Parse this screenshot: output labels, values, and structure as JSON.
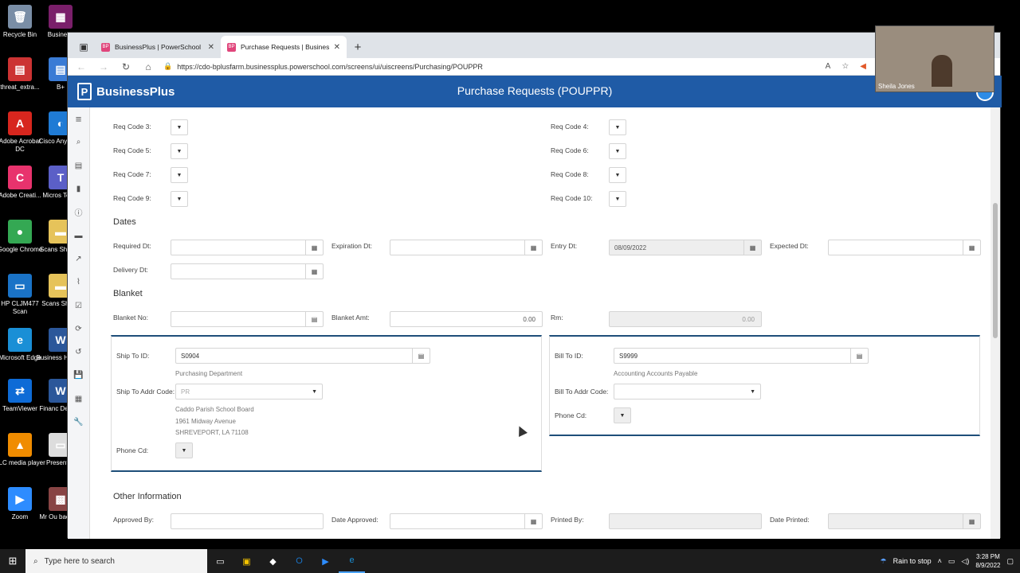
{
  "desktop": {
    "icons": [
      {
        "label": "Recycle Bin",
        "color": "#7a8ea6",
        "glyph": "🗑"
      },
      {
        "label": "threat_extra...",
        "color": "#cc3333",
        "glyph": "▤"
      },
      {
        "label": "Adobe Acrobat DC",
        "color": "#d7261e",
        "glyph": "A"
      },
      {
        "label": "Adobe Creati...",
        "color": "#e8336d",
        "glyph": "C"
      },
      {
        "label": "Google Chrome",
        "color": "#34a853",
        "glyph": "●"
      },
      {
        "label": "HP CLJM477 Scan",
        "color": "#1a73c7",
        "glyph": "▭"
      },
      {
        "label": "Microsoft Edge",
        "color": "#1a8fd6",
        "glyph": "e"
      },
      {
        "label": "TeamViewer",
        "color": "#0e6bd6",
        "glyph": "⇄"
      },
      {
        "label": "VLC media player",
        "color": "#f08c00",
        "glyph": "▲"
      },
      {
        "label": "Zoom",
        "color": "#2d8cff",
        "glyph": "▶"
      }
    ],
    "icons2": [
      {
        "label": "Business",
        "color": "#7a1f6a",
        "glyph": "▦"
      },
      {
        "label": "B+",
        "color": "#3a7bd5",
        "glyph": "▤"
      },
      {
        "label": "Cisco AnyConn",
        "color": "#1f7bd5",
        "glyph": "◐"
      },
      {
        "label": "Micros Team",
        "color": "#5b5fc7",
        "glyph": "T"
      },
      {
        "label": "Scans Shortcu",
        "color": "#e6c35a",
        "glyph": "▬"
      },
      {
        "label": "Scans Shortc",
        "color": "#e6c35a",
        "glyph": "▬"
      },
      {
        "label": "Business How To",
        "color": "#2b579a",
        "glyph": "W"
      },
      {
        "label": "Financ Deadlin",
        "color": "#2b579a",
        "glyph": "W"
      },
      {
        "label": "Presentati",
        "color": "#dddddd",
        "glyph": "▭"
      },
      {
        "label": "Mr Ou backgro",
        "color": "#884444",
        "glyph": "▩"
      }
    ]
  },
  "browser": {
    "tabs": [
      {
        "title": "BusinessPlus | PowerSchool",
        "active": false
      },
      {
        "title": "Purchase Requests | BusinessPlu",
        "active": true
      }
    ],
    "url": "https://cdo-bplusfarm.businessplus.powerschool.com/screens/ui/uiscreens/Purchasing/POUPPR"
  },
  "app": {
    "brand": "BusinessPlus",
    "title": "Purchase Requests (POUPPR)"
  },
  "form": {
    "req_codes": {
      "code3": "Req Code 3:",
      "code4": "Req Code 4:",
      "code5": "Req Code 5:",
      "code6": "Req Code 6:",
      "code7": "Req Code 7:",
      "code8": "Req Code 8:",
      "code9": "Req Code 9:",
      "code10": "Req Code 10:"
    },
    "dates": {
      "title": "Dates",
      "required_label": "Required Dt:",
      "expiration_label": "Expiration Dt:",
      "entry_label": "Entry Dt:",
      "entry_value": "08/09/2022",
      "expected_label": "Expected Dt:",
      "delivery_label": "Delivery Dt:"
    },
    "blanket": {
      "title": "Blanket",
      "no_label": "Blanket No:",
      "amt_label": "Blanket Amt:",
      "amt_value": "0.00",
      "rm_label": "Rm:",
      "rm_value": "0.00"
    },
    "ship": {
      "id_label": "Ship To ID:",
      "id_value": "S0904",
      "dept": "Purchasing Department",
      "addr_code_label": "Ship To Addr Code:",
      "addr_code_value": "PR",
      "addr1": "Caddo Parish School Board",
      "addr2": "1961 Midway Avenue",
      "addr3": "SHREVEPORT, LA 71108",
      "phone_label": "Phone Cd:"
    },
    "bill": {
      "id_label": "Bill To ID:",
      "id_value": "S9999",
      "dept": "Accounting Accounts Payable",
      "addr_code_label": "Bill To Addr Code:",
      "phone_label": "Phone Cd:"
    },
    "other": {
      "title": "Other Information",
      "approved_by_label": "Approved By:",
      "date_approved_label": "Date Approved:",
      "printed_by_label": "Printed By:",
      "date_printed_label": "Date Printed:"
    }
  },
  "video": {
    "name": "Sheila Jones"
  },
  "taskbar": {
    "search_placeholder": "Type here to search",
    "weather": "Rain to stop",
    "time": "3:28 PM",
    "date": "8/9/2022"
  }
}
